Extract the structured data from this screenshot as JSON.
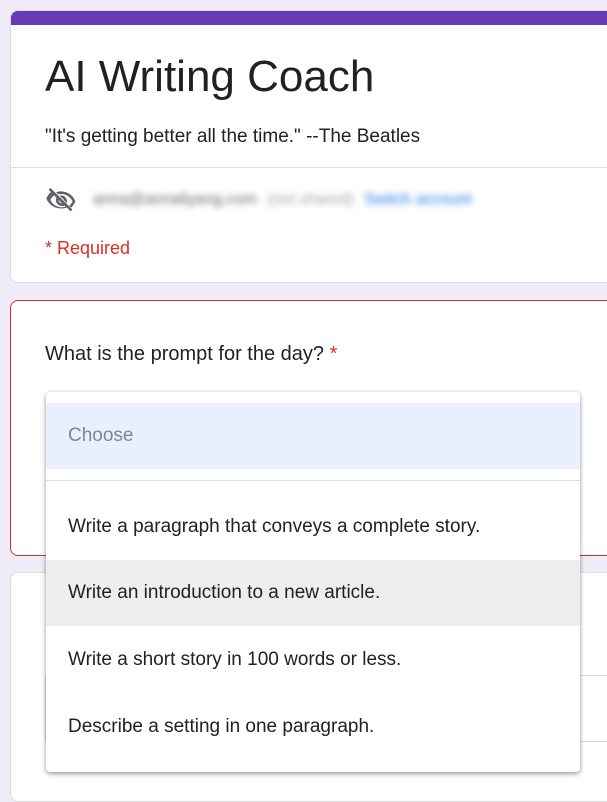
{
  "form": {
    "title": "AI Writing Coach",
    "description": "\"It's getting better all the time.\"  --The Beatles",
    "account": {
      "email": "anna@annaliyang.com",
      "not_shared": "(not shared)",
      "switch_account": "Switch account",
      "icon": "eye-off-icon"
    },
    "required_note": "* Required"
  },
  "question": {
    "title": "What is the prompt for the day?",
    "required_marker": "*"
  },
  "dropdown": {
    "placeholder": "Choose",
    "highlighted_index": 1,
    "options": [
      "Write a paragraph that conveys a complete story.",
      "Write an introduction to a new article.",
      "Write a short story in 100 words or less.",
      "Describe a setting in one paragraph."
    ]
  },
  "colors": {
    "accent": "#673ab7",
    "background": "#f0ebf8",
    "required": "#d93025",
    "placeholder_highlight": "#e8f0fe",
    "hover": "#eeeeee"
  }
}
